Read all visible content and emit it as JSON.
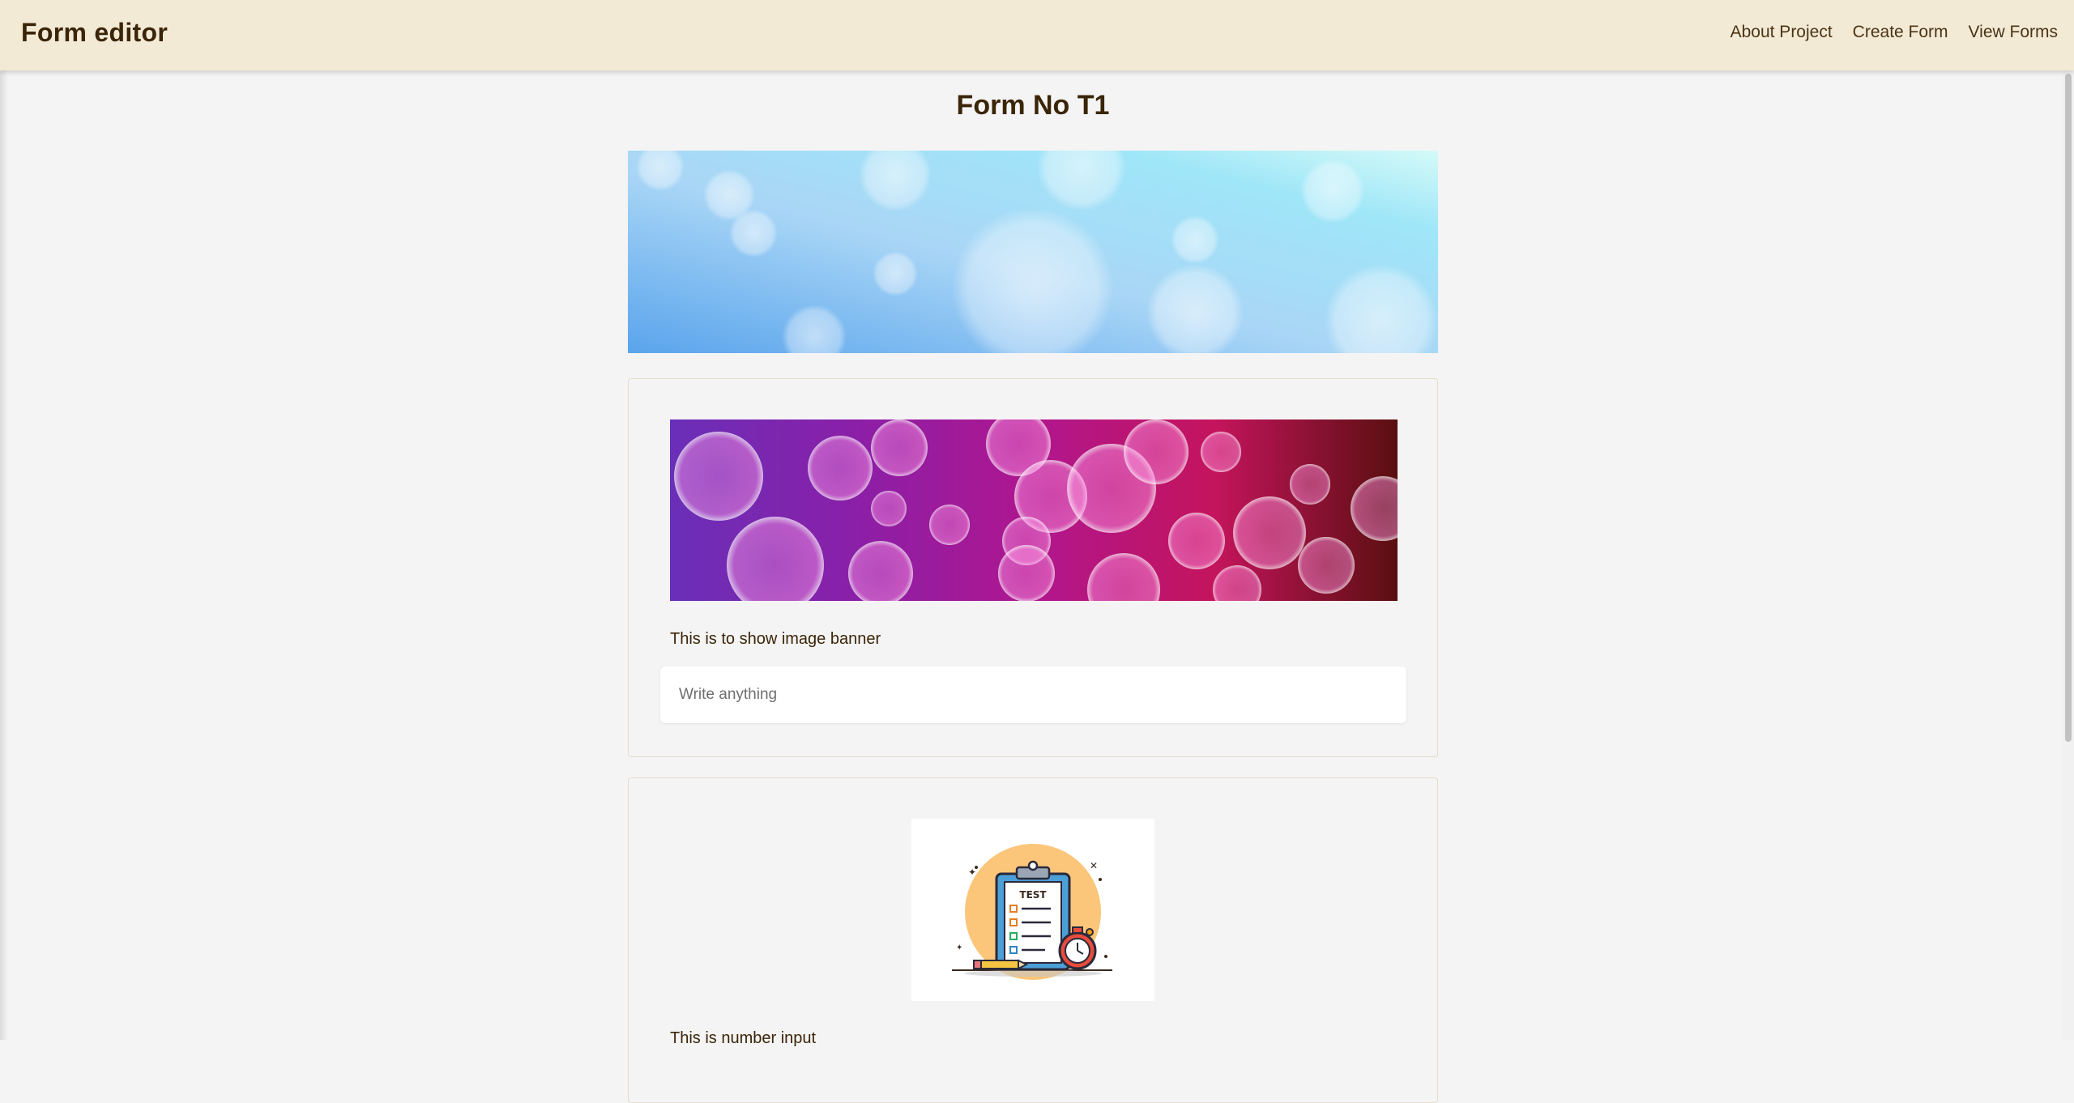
{
  "navbar": {
    "brand": "Form editor",
    "links": [
      "About Project",
      "Create Form",
      "View Forms"
    ]
  },
  "form": {
    "title": "Form No T1",
    "fields": [
      {
        "caption": "This is to show image banner",
        "input_placeholder": "Write anything"
      },
      {
        "image_label": "TEST",
        "caption": "This is number input"
      }
    ]
  },
  "colors": {
    "navbar_bg": "#f3ead6",
    "page_bg": "#f4f4f4",
    "brand_text": "#3b2508"
  },
  "icons": {
    "test_illustration": "clipboard-checklist-stopwatch-icon"
  }
}
